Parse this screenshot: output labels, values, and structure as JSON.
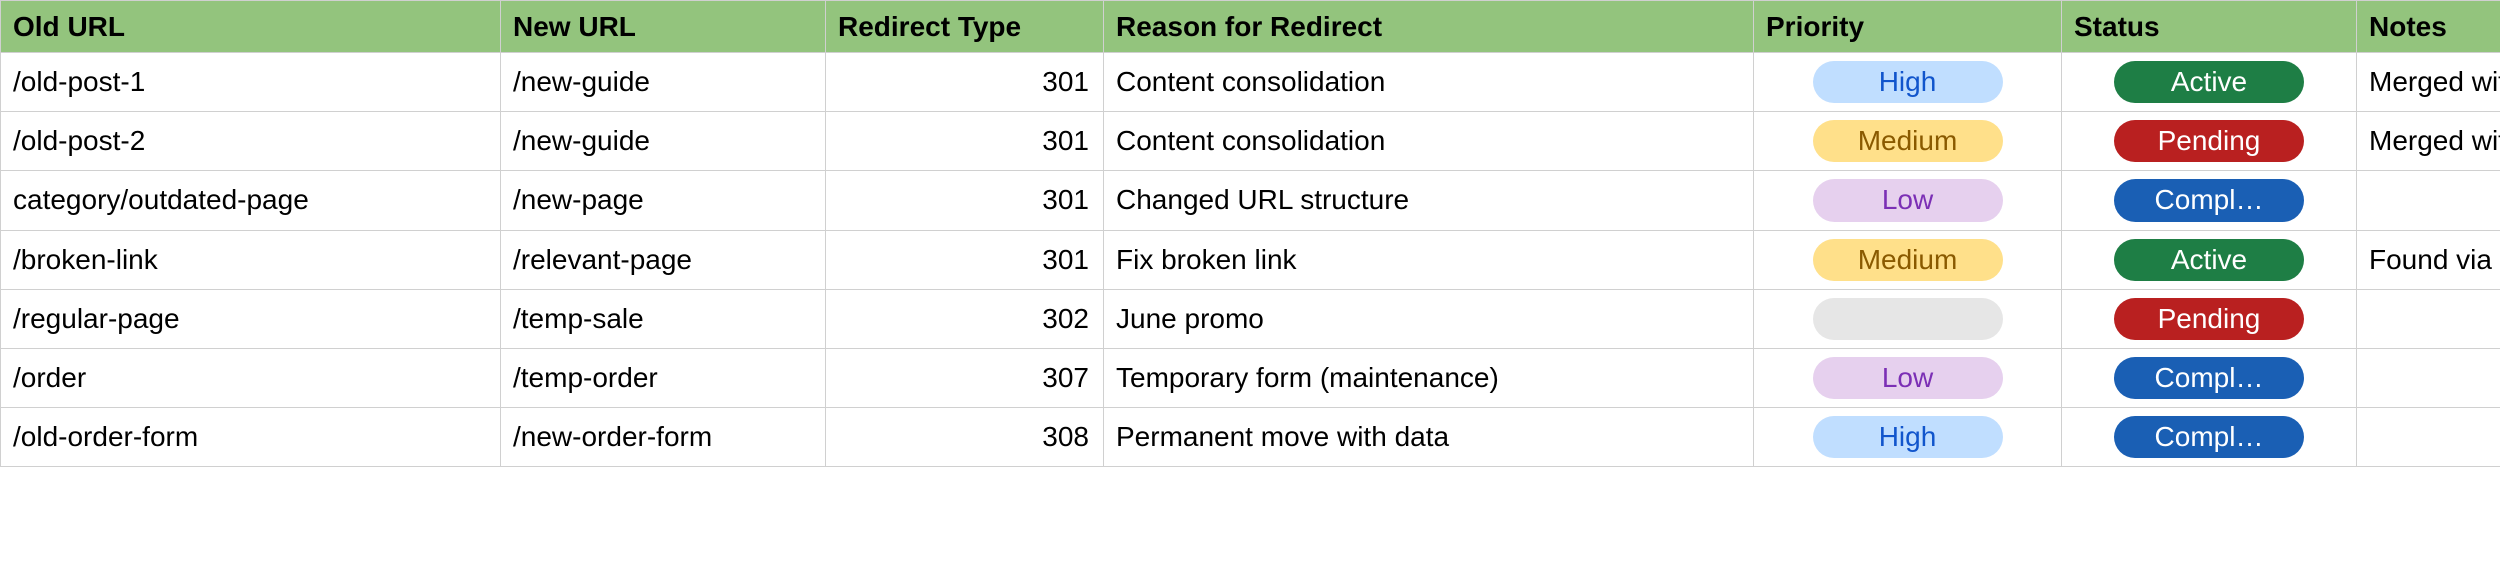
{
  "headers": {
    "old_url": "Old URL",
    "new_url": "New URL",
    "redirect_type": "Redirect Type",
    "reason": "Reason for Redirect",
    "priority": "Priority",
    "status": "Status",
    "notes": "Notes"
  },
  "priority_labels": {
    "high": "High",
    "medium": "Medium",
    "low": "Low",
    "blank": ""
  },
  "status_labels": {
    "active": "Active",
    "pending": "Pending",
    "completed": "Compl…"
  },
  "rows": [
    {
      "old_url": "/old-post-1",
      "new_url": "/new-guide",
      "redirect_type": "301",
      "reason": "Content consolidation",
      "priority": "high",
      "status": "active",
      "notes": "Merged with"
    },
    {
      "old_url": "/old-post-2",
      "new_url": "/new-guide",
      "redirect_type": "301",
      "reason": "Content consolidation",
      "priority": "medium",
      "status": "pending",
      "notes": "Merged with"
    },
    {
      "old_url": "category/outdated-page",
      "new_url": "/new-page",
      "redirect_type": "301",
      "reason": "Changed URL structure",
      "priority": "low",
      "status": "completed",
      "notes": ""
    },
    {
      "old_url": "/broken-link",
      "new_url": "/relevant-page",
      "redirect_type": "301",
      "reason": "Fix broken link",
      "priority": "medium",
      "status": "active",
      "notes": "Found via G"
    },
    {
      "old_url": "/regular-page",
      "new_url": "/temp-sale",
      "redirect_type": "302",
      "reason": "June promo",
      "priority": "blank",
      "status": "pending",
      "notes": ""
    },
    {
      "old_url": "/order",
      "new_url": "/temp-order",
      "redirect_type": "307",
      "reason": "Temporary form (maintenance)",
      "priority": "low",
      "status": "completed",
      "notes": ""
    },
    {
      "old_url": "/old-order-form",
      "new_url": "/new-order-form",
      "redirect_type": "308",
      "reason": "Permanent move with data",
      "priority": "high",
      "status": "completed",
      "notes": ""
    }
  ]
}
